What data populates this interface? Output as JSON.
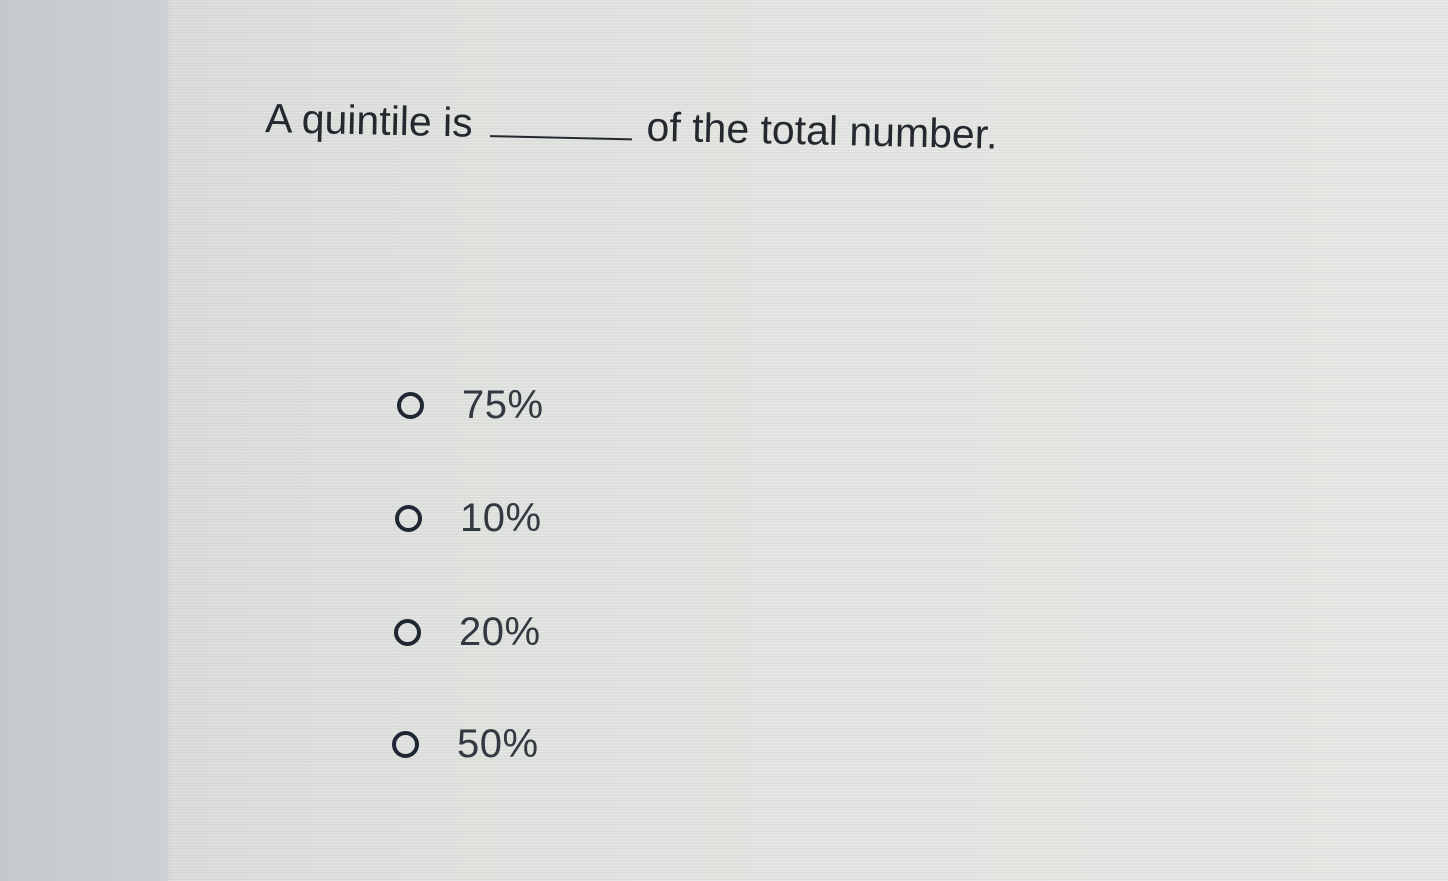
{
  "question": {
    "prefix": "A quintile is",
    "suffix": "of the total number."
  },
  "options": [
    {
      "label": "75%",
      "selected": false
    },
    {
      "label": "10%",
      "selected": false
    },
    {
      "label": "20%",
      "selected": false
    },
    {
      "label": "50%",
      "selected": false
    }
  ]
}
